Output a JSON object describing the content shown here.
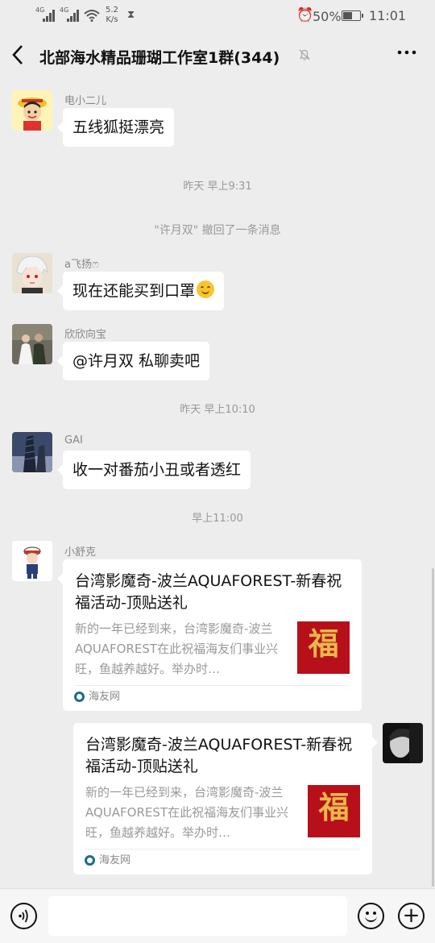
{
  "status_bar": {
    "signal1_label": "4G",
    "signal2_label": "4G",
    "net_speed": "5.2",
    "net_speed_unit": "K/s",
    "battery_percent": "50%",
    "battery_level": 0.5,
    "time": "11:01"
  },
  "header": {
    "back_icon": "chevron-left-icon",
    "title": "北部海水精品珊瑚工作室1群(344)",
    "mute_icon": "bell-off-icon",
    "more_icon": "more-dots-icon"
  },
  "messages": [
    {
      "sender": "电小二儿",
      "text": "五线狐挺漂亮"
    },
    {
      "sender": "a飞扬ෆ",
      "text": "现在还能买到口罩"
    },
    {
      "sender": "欣欣向宝",
      "text": "@许月双  私聊卖吧"
    },
    {
      "sender": "GAI",
      "text": "收一对番茄小丑或者透红"
    }
  ],
  "timestamps": [
    "昨天 早上9:31",
    "昨天 早上10:10",
    "早上11:00"
  ],
  "system_notice": "\"许月双\" 撤回了一条消息",
  "link_sender": "小舒克",
  "link_card": {
    "title": "台湾影魔奇-波兰AQUAFOREST-新春祝福活动-顶贴送礼",
    "description": "新的一年已经到来，台湾影魔奇-波兰AQUAFOREST在此祝福海友们事业兴旺，鱼越养越好。举办时…",
    "thumb_char": "福",
    "source": "海友网"
  },
  "link_card_forwarded": {
    "title": "台湾影魔奇-波兰AQUAFOREST-新春祝福活动-顶贴送礼",
    "description": "新的一年已经到来，台湾影魔奇-波兰AQUAFOREST在此祝福海友们事业兴旺，鱼越养越好。举办时…",
    "thumb_char": "福",
    "source": "海友网"
  },
  "input_bar": {
    "voice_icon": "voice-icon",
    "emoji_icon": "emoji-icon",
    "plus_icon": "plus-icon"
  },
  "colors": {
    "background": "#ededed",
    "bubble": "#ffffff",
    "accent_red": "#b8101a"
  }
}
